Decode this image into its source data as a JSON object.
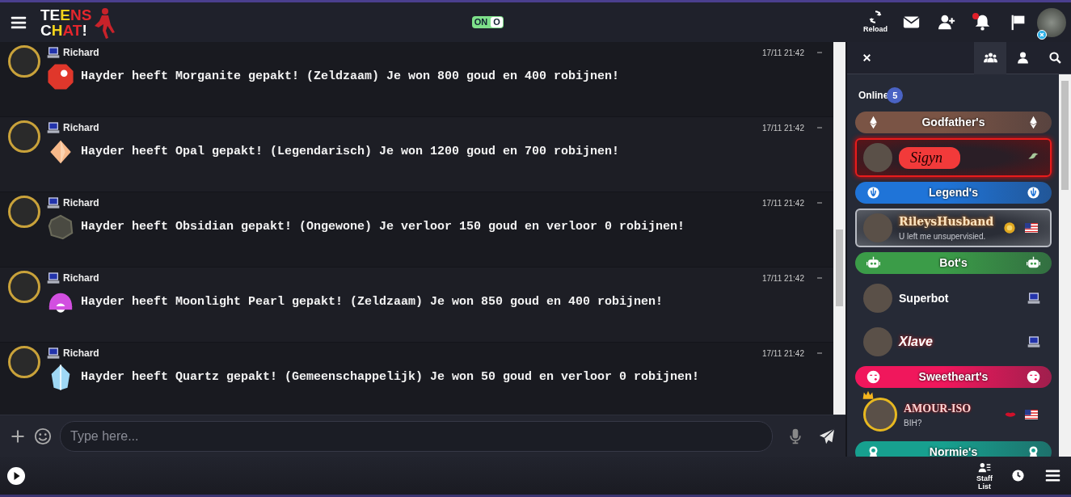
{
  "topbar": {
    "logo": [
      "TEENS",
      "CHAT!"
    ],
    "toggle": {
      "on_label": "ON",
      "knob_label": "O",
      "on": true
    },
    "actions": [
      {
        "kind": "reload",
        "label": "Reload",
        "alert": false
      },
      {
        "kind": "mail",
        "alert": false
      },
      {
        "kind": "adduser",
        "alert": false
      },
      {
        "kind": "bell",
        "alert": true
      },
      {
        "kind": "flag",
        "alert": false
      }
    ]
  },
  "messages": [
    {
      "user": "Richard",
      "time": "17/11 21:42",
      "text": "Hayder heeft Morganite gepakt! (Zeldzaam) Je won 800 goud en 400 robijnen!",
      "gem": {
        "kind": "round",
        "color": "#e0372b"
      }
    },
    {
      "user": "Richard",
      "time": "17/11 21:42",
      "text": "Hayder heeft Opal gepakt! (Legendarisch) Je won 1200 goud en 700 robijnen!",
      "gem": {
        "kind": "diamond",
        "color": "#f7b98a"
      }
    },
    {
      "user": "Richard",
      "time": "17/11 21:42",
      "text": "Hayder heeft Obsidian gepakt! (Ongewone) Je verloor 150 goud en verloor 0 robijnen!",
      "gem": {
        "kind": "rock",
        "color": "#4a4a42"
      }
    },
    {
      "user": "Richard",
      "time": "17/11 21:42",
      "text": "Hayder heeft Moonlight Pearl gepakt! (Zeldzaam) Je won 850 goud en 400 robijnen!",
      "gem": {
        "kind": "shell",
        "color": "#d24fe0"
      }
    },
    {
      "user": "Richard",
      "time": "17/11 21:42",
      "text": "Hayder heeft Quartz gepakt! (Gemeenschappelijk) Je won 50 goud en verloor 0 robijnen!",
      "gem": {
        "kind": "crystal",
        "color": "#9fd8f5"
      }
    }
  ],
  "composer": {
    "placeholder": "Type here..."
  },
  "panel": {
    "tabs": [
      {
        "kind": "group",
        "selected": true
      },
      {
        "kind": "user",
        "selected": false
      },
      {
        "kind": "search",
        "selected": false
      }
    ],
    "online_label": "Online",
    "online_count": "5",
    "items": [
      {
        "kind": "group",
        "label": "Godfather's",
        "color": "#7a5445"
      },
      {
        "kind": "user",
        "name": "Sigyn"
      },
      {
        "kind": "group",
        "label": "Legend's",
        "color": "#1f74d8"
      },
      {
        "kind": "user",
        "name": "RileysHusband",
        "mood": "U left me unsupervisied."
      },
      {
        "kind": "group",
        "label": "Bot's",
        "color": "#3b9c48"
      },
      {
        "kind": "user",
        "name": "Superbot"
      },
      {
        "kind": "user",
        "name": "Xlave"
      },
      {
        "kind": "group",
        "label": "Sweetheart's",
        "color": "#f0175c"
      },
      {
        "kind": "user",
        "name": "AMOUR-ISO",
        "mood": "BIH?",
        "crown": true
      },
      {
        "kind": "group",
        "label": "Normie's",
        "color": "#17a08f"
      }
    ]
  },
  "bottombar": {
    "staff_label": "Staff List"
  }
}
